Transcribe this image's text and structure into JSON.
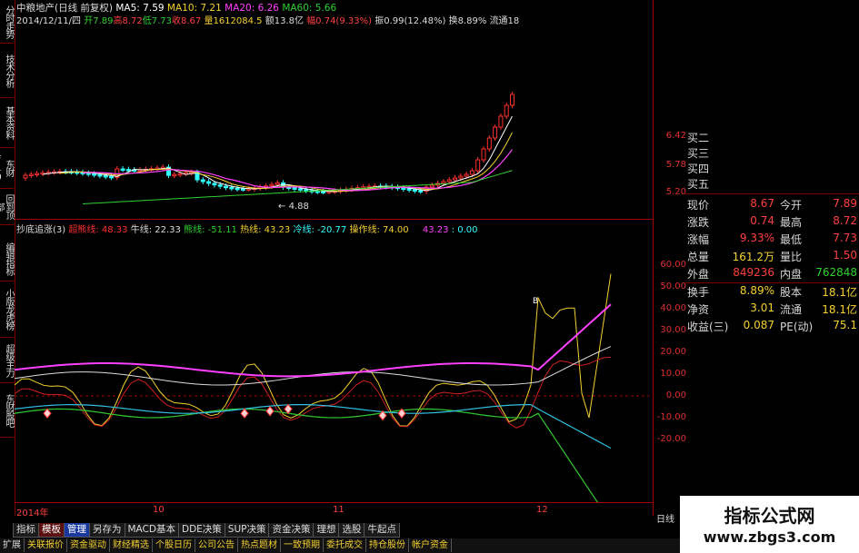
{
  "left_tabs": [
    "分时走势",
    "技术分析",
    "基本资料",
    "东财F10",
    "回到顶部"
  ],
  "left_tabs_lower": [
    "编辑指标",
    "小版龙虎榜",
    "超级主力",
    "东财股吧"
  ],
  "header": {
    "stock_name": "中粮地产(日线 前复权)",
    "ma5": "MA5: 7.59",
    "ma10": "MA10: 7.21",
    "ma20": "MA20: 6.26",
    "ma60": "MA60: 5.66",
    "date": "2014/12/11/四",
    "open": "开7.89",
    "high": "高8.72",
    "low": "低7.73",
    "close": "收8.67",
    "volume": "量1612084.5",
    "amount": "额13.8亿",
    "change": "幅0.74(9.33%)",
    "amplitude": "振0.99(12.48%)",
    "turnover": "换8.89%",
    "float": "流通18"
  },
  "price_axis": [
    "6.42",
    "5.78",
    "5.20"
  ],
  "price_low_label": "4.88",
  "indicator_header": {
    "name": "抄底追涨(3)",
    "l1": "超熊线: 48.33",
    "l2": "牛线: 22.33",
    "l3": "熊线: -51.11",
    "l4": "热线: 43.23",
    "l5": "冷线: -20.77",
    "l6": "操作线: 74.00",
    "l7": "43.23",
    "l8": ": 0.00"
  },
  "ind_axis": [
    "60.00",
    "50.00",
    "40.00",
    "30.00",
    "20.00",
    "10.00",
    "0.00",
    "-10.00",
    "-20.00"
  ],
  "date_axis": [
    "2014年",
    "10",
    "11",
    "12"
  ],
  "period_label": "日线",
  "buy_marker": "B",
  "quote": {
    "buy_levels": [
      "买二",
      "买三",
      "买四",
      "买五"
    ],
    "rows": [
      {
        "l": "现价",
        "v": "8.67",
        "vc": "#ff4040",
        "l2": "今开",
        "v2": "7.89",
        "v2c": "#ff4040"
      },
      {
        "l": "涨跌",
        "v": "0.74",
        "vc": "#ff4040",
        "l2": "最高",
        "v2": "8.72",
        "v2c": "#ff4040"
      },
      {
        "l": "涨幅",
        "v": "9.33%",
        "vc": "#ff4040",
        "l2": "最低",
        "v2": "7.73",
        "v2c": "#ff4040"
      },
      {
        "l": "总量",
        "v": "161.2万",
        "vc": "#f4d030",
        "l2": "量比",
        "v2": "1.50",
        "v2c": "#ff4040"
      },
      {
        "l": "外盘",
        "v": "849236",
        "vc": "#ff4040",
        "l2": "内盘",
        "v2": "762848",
        "v2c": "#30d030"
      },
      {
        "l": "换手",
        "v": "8.89%",
        "vc": "#f4d030",
        "l2": "股本",
        "v2": "18.1亿",
        "v2c": "#f4d030"
      },
      {
        "l": "净资",
        "v": "3.01",
        "vc": "#f4d030",
        "l2": "流通",
        "v2": "18.1亿",
        "v2c": "#f4d030"
      },
      {
        "l": "收益(三)",
        "v": "0.087",
        "vc": "#f4d030",
        "l2": "PE(动)",
        "v2": "75.1",
        "v2c": "#f4d030"
      }
    ]
  },
  "bottom_tabs1": [
    "指标",
    "模板",
    "管理",
    "另存为",
    "MACD基本",
    "DDE决策",
    "SUP决策",
    "资金决策",
    "理想",
    "选股",
    "牛起点"
  ],
  "bottom_tabs2": [
    "扩展",
    "关联报价",
    "资金驱动",
    "财经精选",
    "个股日历",
    "公司公告",
    "热点题材",
    "一致预期",
    "委托成交",
    "持仓股份",
    "帐户资金"
  ],
  "watermark": {
    "title": "指标公式网",
    "url": "www.zbgs3.com"
  },
  "colors": {
    "up": "#ff3030",
    "down": "#30ffff",
    "ma5": "#ffffff",
    "ma10": "#f4d030",
    "ma20": "#ff40ff",
    "ma60": "#30d030"
  }
}
